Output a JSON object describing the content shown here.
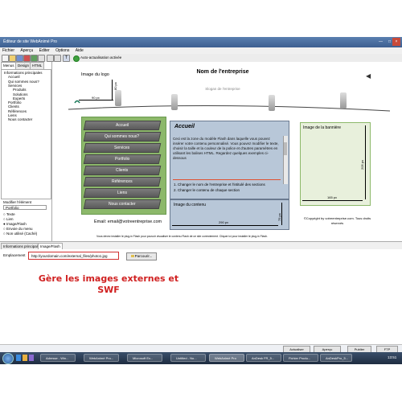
{
  "window": {
    "title": "Éditeur de site WebAnimé Pro"
  },
  "menubar": [
    "Fichier",
    "Aperçu",
    "Editer",
    "Options",
    "Aide"
  ],
  "toolbar": {
    "auto_update": "Auto-actualisation activée"
  },
  "sidebar": {
    "tabs": [
      "Menus",
      "Design",
      "HTML"
    ],
    "tree": [
      "Informations principales",
      "Accueil",
      "Qui sommes nous?",
      "Services",
      "Produits",
      "Solutions",
      "Experts",
      "Portfolio",
      "Clients",
      "Références",
      "Liens",
      "Nous contacter"
    ],
    "field_label": "Modifier l'élément",
    "field_value": "Portfolio",
    "radios": [
      "Texte",
      "Lien",
      "Image/Flash",
      "Envoie du menu",
      "Non utilisé (Caché)"
    ]
  },
  "canvas": {
    "logo_label": "Image du logo",
    "logo_w": "90 px",
    "logo_h": "80 px",
    "company_name": "Nom de l'entreprise",
    "slogan": "Slogan de l'entreprise",
    "menu_items": [
      "Accueil",
      "Qui sommes nous?",
      "Services",
      "Portfolio",
      "Clients",
      "Références",
      "Liens",
      "Nous contacter"
    ],
    "email": "Email: email@votreentreprise.com",
    "accueil_title": "Accueil",
    "accueil_text": "Ceci est la zone du modèle Flash dans laquelle vous pouvez insérer votre contenu personnalisé. Vous pouvez modifier le texte, choisir la taille et la couleur de la police et d'autres paramètres en utilisant les balises HTML. Regardez quelques exemples ci-dessous",
    "accueil_list": [
      "1. Changer le nom de l'entreprise et l'intitulé des sections",
      "2. Changer le contenu de chaque section"
    ],
    "content_label": "Image du contenu",
    "content_w": "290 px",
    "content_h": "75 px",
    "banner_label": "Image de la bannière",
    "banner_w": "165 px",
    "banner_h": "205 px",
    "copyright": "©Copyright by votreentreprise.com. Tous droits réservés",
    "note": "Vous devez installer le plug-in Flash pour pouvoir visualiser le contenu Flash de ce site correctement. Cliquer ici pour installer le plug-in Flash."
  },
  "bottom_tabs": [
    "Informations principales",
    "Image/Flash"
  ],
  "lower": {
    "location_label": "Emplacement",
    "url": "http://yourdomain.com/external_files/photo1.jpg",
    "browse": "Parcourir...",
    "headline": "Gère les images externes et SWF"
  },
  "actions": [
    "Actualiser",
    "Aperçu",
    "Publier",
    "FTP"
  ],
  "taskbar": {
    "items": [
      "Adresse - Win...",
      "WebAnimé Pro...",
      "Microsoft Ex...",
      "Untitled - No...",
      "WebAnimé Pro",
      "AnDesk FR_5...",
      "Fichier Produ...",
      "AnDeskPro_5..."
    ],
    "time": "13:51"
  },
  "colors": {
    "menu_green": "#8cb86a",
    "accueil_blue": "#b8c7d8",
    "headline_red": "#d02020"
  }
}
